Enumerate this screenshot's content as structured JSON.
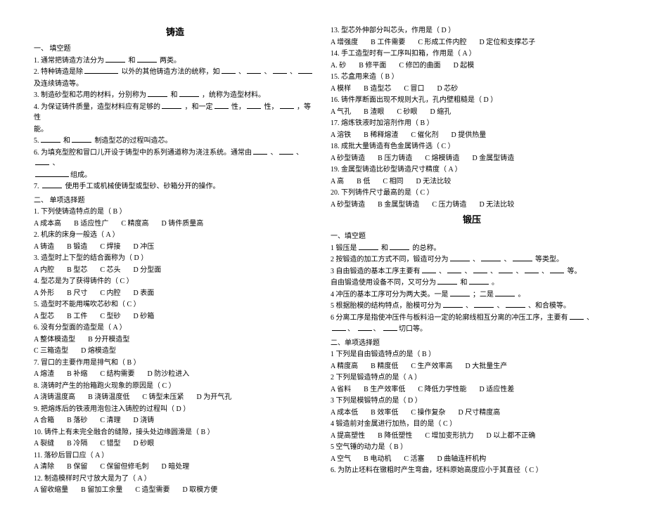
{
  "left": {
    "title": "铸造",
    "section1": "一、 填空题",
    "l1a": "1. 通常把铸造方法分为",
    "l1b": "和",
    "l1c": "两类。",
    "l2a": "2. 特种铸造是除",
    "l2b": "以外的其他铸造方法的统称，如",
    "l2c": "、",
    "l2d": "、",
    "l2e": "、",
    "l3": "及连续铸造等。",
    "l4a": "3. 制造砂型和芯用的材料，分别称为",
    "l4b": "和",
    "l4c": "，统称为造型材料。",
    "l5a": "4. 为保证铸件质量，造型材料应有足够的",
    "l5b": "，和一定",
    "l5c": "性，",
    "l5d": "性，",
    "l5e": "，等性",
    "l6": "能。",
    "l7a": "5.",
    "l7b": "和",
    "l7c": "制造型芯的过程叫造芯。",
    "l8a": "6. 为填充型腔和冒口儿开设于铸型中的系列通道称为浇注系统。通常由",
    "l8b": "、",
    "l8c": "、",
    "l8d": "、",
    "l9": "组成。",
    "l10a": "7. ",
    "l10b": "使用手工或机械使铸型或型砂、砂箱分开的操作。",
    "section2": "二、 单项选择题",
    "q1": "1. 下列使铸造特点的是（ B ）",
    "q1a": "A 成本高",
    "q1b": "B 适应性广",
    "q1c": "C 精度高",
    "q1d": "D 铸件质量高",
    "q2": "2. 机床的床身一般选（ A ）",
    "q2a": "A 铸造",
    "q2b": "B 锻造",
    "q2c": "C 焊接",
    "q2d": "D 冲压",
    "q3": "3. 造型时上下型的结合面称为（ D ）",
    "q3a": "A 内腔",
    "q3b": "B 型芯",
    "q3c": "C 芯头",
    "q3d": "D 分型面",
    "q4": "4. 型芯是为了获得铸件的（ C ）",
    "q4a": "A 外形",
    "q4b": "B 尺寸",
    "q4c": "C 内腔",
    "q4d": "D 表面",
    "q5": "5. 造型时不能用嘴吹芯砂和（ C ）",
    "q5a": "A 型芯",
    "q5b": "B 工件",
    "q5c": "C 型砂",
    "q5d": "D 砂箱",
    "q6": "6. 没有分型面的造型是（ A ）",
    "q6a": "A 整体模造型",
    "q6b": "B 分开模造型",
    "q6c": "C 三箱造型",
    "q6d": "D 熔模造型",
    "q7": "7. 冒口的主要作用是排气和（ B ）",
    "q7a": "A 熔渣",
    "q7b": "B 补缩",
    "q7c": "C 结构需要",
    "q7d": "D 防沙粒进入",
    "q8": "8. 浇铸时产生的抬箱跑火现象的原因是（ C ）",
    "q8a": "A 浇铸温度高",
    "q8b": "B 浇铸温度低",
    "q8c": "C 铸型未压紧",
    "q8d": "D 为开气孔",
    "q9": "9. 把熔炼后的铁液用泡包注入铸腔的过程叫（ D ）",
    "q9a": "A 合箱",
    "q9b": "B 落砂",
    "q9c": "C 清理",
    "q9d": "D 浇铸",
    "q10": "10. 铸件上有未完全融合的缝隙，接头处边缘圆滑是（ B ）",
    "q10a": "A 裂缝",
    "q10b": "B 冷隔",
    "q10c": "C 错型",
    "q10d": "D 砂眼",
    "q11": "11. 落砂后冒口应（ A ）",
    "q11a": "A 清除",
    "q11b": "B 保留",
    "q11c": "C 保留但修毛刺",
    "q11d": "D 暗处理",
    "q12": "12. 制造模样时尺寸放大是为了（ A ）",
    "q12a": "A 留收缩量",
    "q12b": "B 留加工余量",
    "q12c": "C 造型需要",
    "q12d": "D 取模方便"
  },
  "right": {
    "r1": "13. 型芯外伸部分叫芯头，作用是（ D ）",
    "r1a": "A 增强度",
    "r1b": "B 工件需要",
    "r1c": "C 形成工件内腔",
    "r1d": "D 定位和支撑芯子",
    "r2": "14. 手工造型时有一工序叫扣箱，作用是（ A ）",
    "r2a": "A. 砂",
    "r2b": "B 修平面",
    "r2c": "C 修凹的曲面",
    "r2d": "D 起模",
    "r3": "15. 芯盒用来造（ B ）",
    "r3a": "A 模样",
    "r3b": "B 造型芯",
    "r3c": "C 冒口",
    "r3d": "D 芯砂",
    "r4": "16. 铸件厚断面出现不规则大孔，孔内壁粗糙是（ D ）",
    "r4a": "A 气孔",
    "r4b": "B 渣眼",
    "r4c": "C 砂眼",
    "r4d": "D 缩孔",
    "r5": "17. 熔炼铁液时加溶剂作用（ B ）",
    "r5a": "A 溶铁",
    "r5b": "B 稀释熔渣",
    "r5c": "C 催化剂",
    "r5d": "D 提供热量",
    "r6": "18. 成批大量铸造有色金属铸件选（ C ）",
    "r6a": "A 砂型铸造",
    "r6b": "B 压力铸造",
    "r6c": "C 熔模铸造",
    "r6d": "D 金属型铸造",
    "r7": "19. 金属型铸造比砂型铸造尺寸精度（ A ）",
    "r7a": "A 高",
    "r7b": "B 低",
    "r7c": "C 相同",
    "r7d": "D 无法比较",
    "r8": "20. 下列铸件尺寸最高的是（ C ）",
    "r8a": "A 砂型铸造",
    "r8b": "B 金属型铸造",
    "r8c": "C 压力铸造",
    "r8d": "D 无法比较",
    "title2": "锻压",
    "sec1b": "一、填空题",
    "b1a": "1 锻压是",
    "b1b": "和",
    "b1c": "的总称。",
    "b2a": "2 按锻造的加工方式不同，锻造可分为",
    "b2b": "、",
    "b2c": "、",
    "b2d": "等类型。",
    "b3a": "3 自由锻造的基本工序主要有",
    "b3b": "、",
    "b3c": "、",
    "b3d": "、",
    "b3e": "、",
    "b3f": "、",
    "b3g": "等。",
    "b4a": "自由锻造使用设备不同，又可分为",
    "b4b": "和",
    "b4c": "。",
    "b5a": "4 冲压的基本工序可分为两大类。一是",
    "b5b": "；二是",
    "b5c": "。",
    "b6a": "5 根据胎模的结构特点，胎模可分为",
    "b6b": "、",
    "b6c": "、",
    "b6d": "、和合模等。",
    "b7a": "6 分离工序是指使冲压件与板料沿一定的轮廓线相互分离的冲压工序，主要有",
    "b7b": "、",
    "b8a": "、",
    "b8b": "、",
    "b8c": "切口等。",
    "sec2b": "二、单项选择题",
    "c1": "1 下列是自由锻造特点的是（ B ）",
    "c1a": "A 精度高",
    "c1b": "B 精度低",
    "c1c": "C 生产效率高",
    "c1d": "D 大批量生产",
    "c2": "2 下列是锻造特点的是（ A ）",
    "c2a": "A 省料",
    "c2b": "B 生产效率低",
    "c2c": "C 降低力学性能",
    "c2d": "D 适应性差",
    "c3": "3 下列是模锻特点的是（ D ）",
    "c3a": "A 成本低",
    "c3b": "B 效率低",
    "c3c": "C 操作复杂",
    "c3d": "D 尺寸精度高",
    "c4": "4 锻造前对金属进行加热，目的是（ C ）",
    "c4a": "A 提高塑性",
    "c4b": "B 降低塑性",
    "c4c": "C 增加变形抗力",
    "c4d": "D 以上都不正确",
    "c5": "5 空气锤的动力是（ B ）",
    "c5a": "A 空气",
    "c5b": "B 电动机",
    "c5c": "C 活塞",
    "c5d": "D 曲轴连杆机构",
    "c6": "6. 为防止坯料在镦粗时产生弯曲，坯料原始高度应小于其直径（ C ）"
  }
}
